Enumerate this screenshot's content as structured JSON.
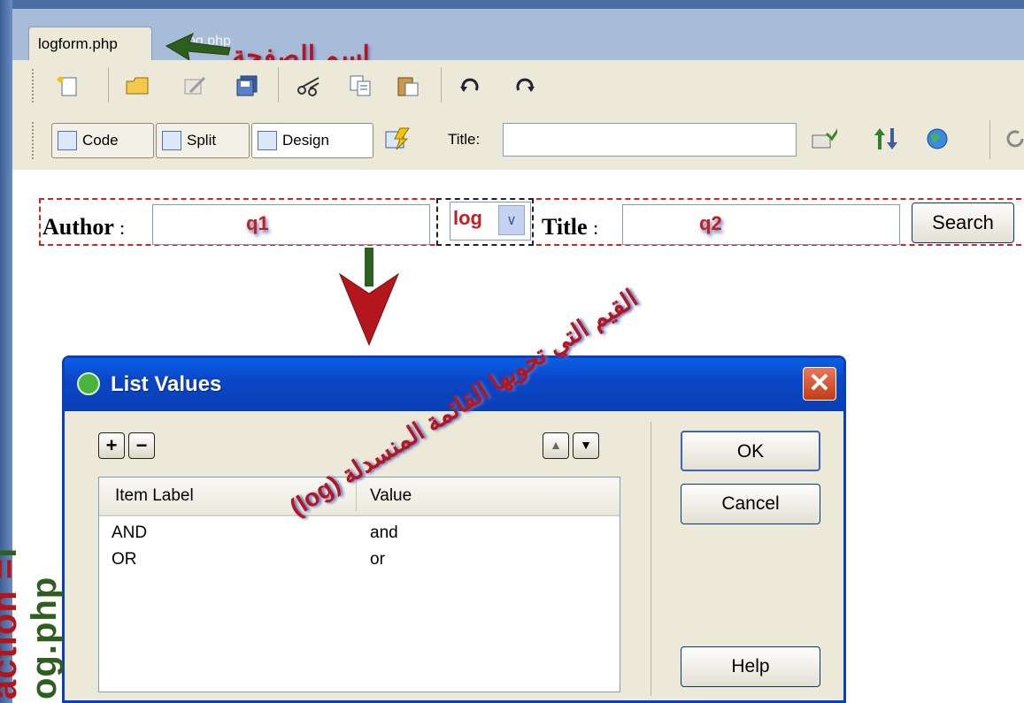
{
  "document_tab": {
    "active_label": "logform.php",
    "inactive_label": "og.php"
  },
  "view_buttons": {
    "code": "Code",
    "split": "Split",
    "design": "Design"
  },
  "title_field": {
    "label": "Title:",
    "value": ""
  },
  "form": {
    "author_label": "Author",
    "title_label": "Title",
    "colon": ":",
    "q1_annotation": "q1",
    "q2_annotation": "q2",
    "select_value": "log",
    "search_button": "Search"
  },
  "dialog": {
    "title": "List Values",
    "close_glyph": "✕",
    "add_glyph": "+",
    "remove_glyph": "−",
    "up_glyph": "▲",
    "down_glyph": "▼",
    "columns": [
      "Item Label",
      "Value"
    ],
    "rows": [
      {
        "label": "AND",
        "value": "and"
      },
      {
        "label": "OR",
        "value": "or"
      }
    ],
    "buttons": {
      "ok": "OK",
      "cancel": "Cancel",
      "help": "Help"
    }
  },
  "annotations": {
    "page_name_ar": "اسم الصفحة",
    "vertical_action": "action =",
    "vertical_file": "l og.php",
    "values_ar_line1": "القيم التي تحويها القائمة المنسدلة (log)"
  },
  "colors": {
    "annotation_red": "#b3161c",
    "annotation_green": "#2f5f1f",
    "xp_blue": "#0a3fb6"
  }
}
